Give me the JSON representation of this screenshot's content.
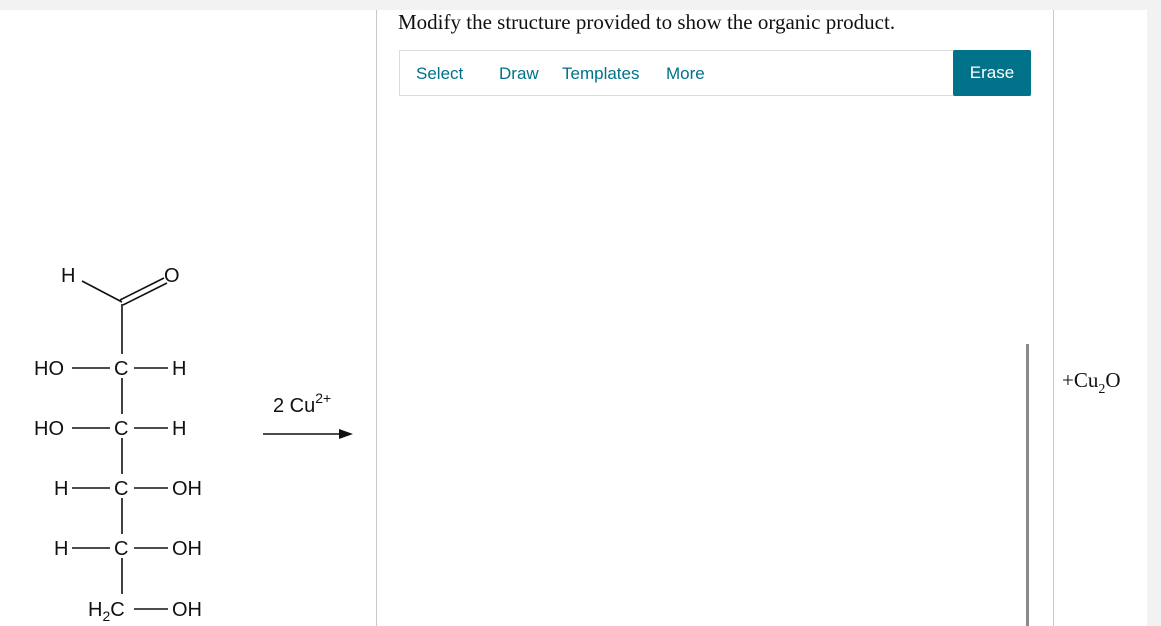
{
  "prompt": "Modify the structure provided to show the organic product.",
  "toolbar": {
    "select_label": "Select",
    "draw_label": "Draw",
    "templates_label": "Templates",
    "more_label": "More",
    "erase_label": "Erase"
  },
  "reactant": {
    "aldehyde_h": "H",
    "aldehyde_o": "O",
    "rows": [
      {
        "left": "HO",
        "center": "C",
        "right": "H"
      },
      {
        "left": "HO",
        "center": "C",
        "right": "H"
      },
      {
        "left": "H",
        "center": "C",
        "right": "OH"
      },
      {
        "left": "H",
        "center": "C",
        "right": "OH"
      }
    ],
    "bottom_c_main": "H",
    "bottom_c_sub": "2",
    "bottom_c_tail": "C",
    "bottom_right": "OH"
  },
  "reagent": {
    "coef": "2 Cu",
    "charge": "2+"
  },
  "byproduct": {
    "prefix": "+Cu",
    "sub": "2",
    "suffix": "O"
  }
}
